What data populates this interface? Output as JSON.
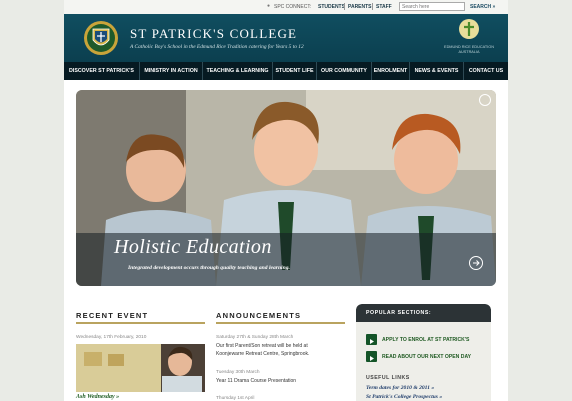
{
  "util": {
    "connect": "SPC CONNECT:",
    "links": [
      "STUDENTS",
      "PARENTS",
      "STAFF"
    ],
    "search_placeholder": "Search here",
    "search_button": "SEARCH »"
  },
  "header": {
    "title": "ST PATRICK'S COLLEGE",
    "tagline": "A Catholic Boy's School in the Edmund Rice Tradition catering for Years 5 to 12",
    "eret_text": "EDMUND RICE EDUCATION AUSTRALIA"
  },
  "nav": [
    "DISCOVER ST PATRICK'S",
    "MINISTRY IN ACTION",
    "TEACHING & LEARNING",
    "STUDENT LIFE",
    "OUR COMMUNITY",
    "ENROLMENT",
    "NEWS & EVENTS",
    "CONTACT US"
  ],
  "hero": {
    "title": "Holistic Education",
    "subtitle": "Integrated development occurs through quality teaching and learning."
  },
  "recent_event": {
    "title": "RECENT EVENT",
    "date": "Wednesday, 17th February, 2010",
    "link": "Ash Wednesday »"
  },
  "announcements": {
    "title": "ANNOUNCEMENTS",
    "items": [
      {
        "date": "Saturday 27th & Sunday 28th March",
        "lines": [
          "Our first Parent/Son retreat will be held at",
          "Koonjewarre Retreat Centre, Springbrook."
        ]
      },
      {
        "date": "Tuesday 30th March",
        "lines": [
          "Year 11 Drama Course Presentation"
        ]
      },
      {
        "date": "Thursday 1st April",
        "lines": []
      }
    ]
  },
  "popular": {
    "title": "POPULAR SECTIONS:",
    "buttons": [
      "APPLY TO ENROL AT ST PATRICK'S",
      "READ ABOUT OUR NEXT OPEN DAY"
    ],
    "useful_title": "USEFUL LINKS",
    "useful_links": [
      "Term dates for 2010 & 2011 »",
      "St Patrick's College Prospectus »"
    ]
  },
  "colors": {
    "header": "#0e4a5c",
    "nav": "#061a22",
    "accent_gold": "#b9a35f",
    "link_green": "#1c5a1f"
  }
}
